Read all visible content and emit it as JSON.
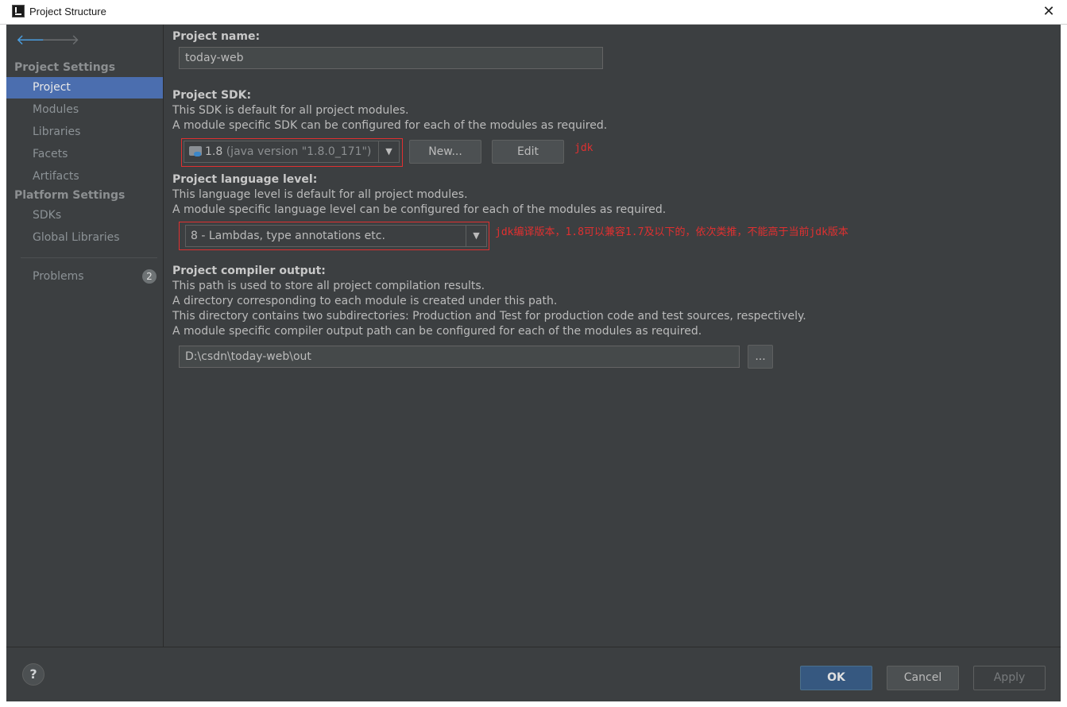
{
  "window": {
    "title": "Project Structure",
    "close_glyph": "✕"
  },
  "sidebar": {
    "sections": [
      {
        "label": "Project Settings",
        "items": [
          {
            "label": "Project",
            "selected": true
          },
          {
            "label": "Modules"
          },
          {
            "label": "Libraries"
          },
          {
            "label": "Facets"
          },
          {
            "label": "Artifacts"
          }
        ]
      },
      {
        "label": "Platform Settings",
        "items": [
          {
            "label": "SDKs"
          },
          {
            "label": "Global Libraries"
          }
        ]
      }
    ],
    "problems": {
      "label": "Problems",
      "count": "2"
    }
  },
  "project_name": {
    "heading": "Project name:",
    "value": "today-web"
  },
  "project_sdk": {
    "heading": "Project SDK:",
    "desc1": "This SDK is default for all project modules.",
    "desc2": "A module specific SDK can be configured for each of the modules as required.",
    "selected_version": "1.8",
    "selected_detail": "(java version \"1.8.0_171\")",
    "new_label": "New...",
    "edit_label": "Edit",
    "annotation": "jdk"
  },
  "language_level": {
    "heading": "Project language level:",
    "desc1": "This language level is default for all project modules.",
    "desc2": "A module specific language level can be configured for each of the modules as required.",
    "selected": "8 - Lambdas, type annotations etc.",
    "annotation": "jdk编译版本，1.8可以兼容1.7及以下的，依次类推，不能高于当前jdk版本"
  },
  "compiler_output": {
    "heading": "Project compiler output:",
    "desc1": "This path is used to store all project compilation results.",
    "desc2": "A directory corresponding to each module is created under this path.",
    "desc3": "This directory contains two subdirectories: Production and Test for production code and test sources, respectively.",
    "desc4": "A module specific compiler output path can be configured for each of the modules as required.",
    "path": "D:\\csdn\\today-web\\out",
    "browse_label": "..."
  },
  "footer": {
    "help_label": "?",
    "ok_label": "OK",
    "cancel_label": "Cancel",
    "apply_label": "Apply"
  },
  "colors": {
    "accent": "#4b6eaf",
    "annotation": "#e03030",
    "background": "#3c3f41"
  }
}
